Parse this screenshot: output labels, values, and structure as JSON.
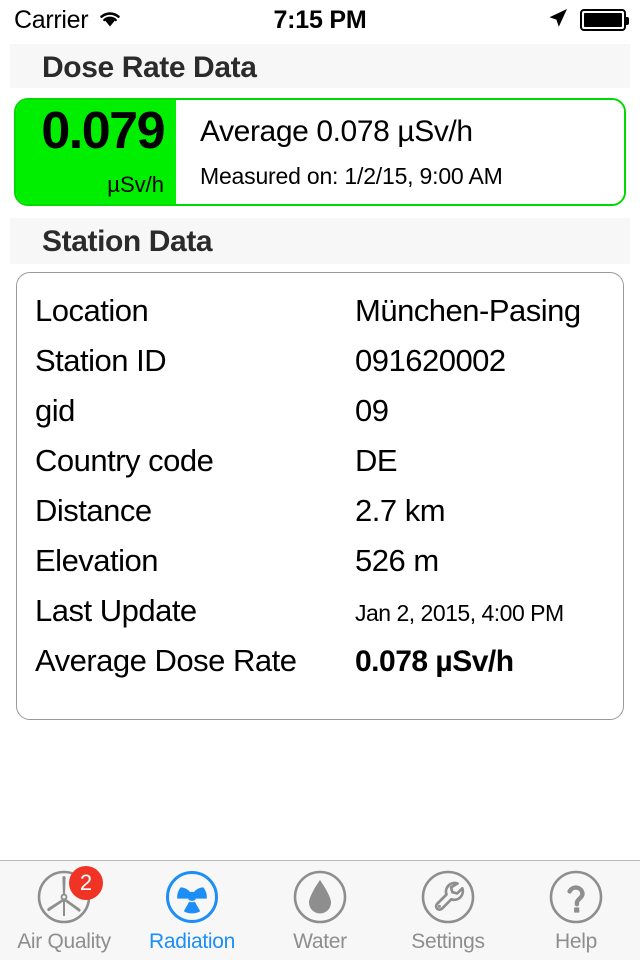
{
  "status_bar": {
    "carrier": "Carrier",
    "time": "7:15 PM",
    "wifi_icon": "wifi-icon",
    "location_icon": "location-arrow-icon",
    "battery_icon": "battery-full-icon"
  },
  "dose_section": {
    "header": "Dose Rate Data",
    "current_value": "0.079",
    "current_unit": "µSv/h",
    "average_line": "Average 0.078 µSv/h",
    "measured_line": "Measured on: 1/2/15, 9:00 AM",
    "accent_color": "#00ee00"
  },
  "station_section": {
    "header": "Station Data",
    "rows": [
      {
        "label": "Location",
        "value": "München-Pasing",
        "style": "normal"
      },
      {
        "label": "Station ID",
        "value": "091620002",
        "style": "normal"
      },
      {
        "label": "gid",
        "value": "09",
        "style": "normal"
      },
      {
        "label": "Country code",
        "value": "DE",
        "style": "normal"
      },
      {
        "label": "Distance",
        "value": "2.7 km",
        "style": "normal"
      },
      {
        "label": "Elevation",
        "value": "526 m",
        "style": "normal"
      },
      {
        "label": "Last Update",
        "value": "Jan 2, 2015, 4:00 PM",
        "style": "small"
      },
      {
        "label": "Average Dose Rate",
        "value": "0.078 µSv/h",
        "style": "bold"
      }
    ]
  },
  "tab_bar": {
    "active_color": "#1d8ef5",
    "inactive_color": "#8e8e8e",
    "badge_color": "#f03325",
    "items": [
      {
        "label": "Air Quality",
        "icon": "wind-turbine-icon",
        "active": false,
        "badge": "2"
      },
      {
        "label": "Radiation",
        "icon": "radiation-trefoil-icon",
        "active": true,
        "badge": ""
      },
      {
        "label": "Water",
        "icon": "water-drop-icon",
        "active": false,
        "badge": ""
      },
      {
        "label": "Settings",
        "icon": "wrench-icon",
        "active": false,
        "badge": ""
      },
      {
        "label": "Help",
        "icon": "question-mark-icon",
        "active": false,
        "badge": ""
      }
    ]
  }
}
